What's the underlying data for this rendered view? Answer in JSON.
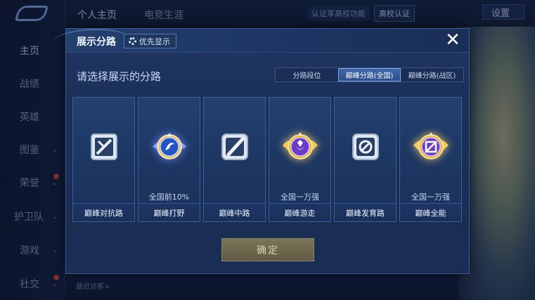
{
  "sidebar": {
    "items": [
      {
        "label": "主页",
        "active": true
      },
      {
        "label": "战绩"
      },
      {
        "label": "英雄"
      },
      {
        "label": "图鉴"
      },
      {
        "label": "荣誉"
      },
      {
        "label": "护卫队"
      },
      {
        "label": "游戏"
      },
      {
        "label": "社交"
      }
    ]
  },
  "topbar": {
    "tabs": [
      "个人主页",
      "电竞生涯"
    ],
    "promo": "认证享高校功能",
    "campus_label": "高校认证",
    "settings_label": "设置"
  },
  "bottom": {
    "recent_label": "最近访客>"
  },
  "dialog": {
    "title": "展示分路",
    "priority_label": "优先显示",
    "close_symbol": "✕",
    "prompt": "请选择展示的分路",
    "segments": [
      {
        "label": "分路段位",
        "active": false
      },
      {
        "label": "巅峰分路(全国)",
        "active": true
      },
      {
        "label": "巅峰分路(战区)",
        "active": false
      }
    ],
    "cards": [
      {
        "label": "巅峰对抗路",
        "rank": "",
        "icon": "silver-sword-shield-icon"
      },
      {
        "label": "巅峰打野",
        "rank": "全国前10%",
        "icon": "blue-winged-jungle-emblem-icon"
      },
      {
        "label": "巅峰中路",
        "rank": "",
        "icon": "silver-staff-icon"
      },
      {
        "label": "巅峰游走",
        "rank": "全国一万强",
        "icon": "gold-winged-roam-emblem-icon"
      },
      {
        "label": "巅峰发育路",
        "rank": "",
        "icon": "silver-target-icon"
      },
      {
        "label": "巅峰全能",
        "rank": "全国一万强",
        "icon": "gold-winged-allround-emblem-icon"
      }
    ],
    "confirm_label": "确定"
  },
  "colors": {
    "dialog_bg": "#1c3058",
    "active_segment": "#3f67a8",
    "confirm_button": "#6d6850",
    "gold_glow": "#ffd26e",
    "blue_glow": "#7888ff"
  }
}
